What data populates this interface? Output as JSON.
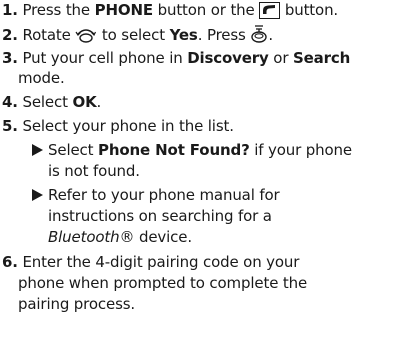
{
  "steps": [
    {
      "num": "1.",
      "a": "Press the ",
      "b": "PHONE",
      "c": " button or the ",
      "d": " button."
    },
    {
      "num": "2.",
      "a": "Rotate ",
      "b": " to select ",
      "c": "Yes",
      "d": ". Press ",
      "e": "."
    },
    {
      "num": "3.",
      "a": "Put your cell phone in ",
      "b": "Discovery",
      "c": " or ",
      "d": "Search",
      "e": "mode."
    },
    {
      "num": "4.",
      "a": "Select ",
      "b": "OK",
      "c": "."
    },
    {
      "num": "5.",
      "a": "Select your phone in the list."
    },
    {
      "num": "6.",
      "line1": "Enter the 4-digit pairing code on your",
      "line2": "phone when prompted to complete the",
      "line3": "pairing process."
    }
  ],
  "sub_items": [
    {
      "a": "Select ",
      "b": "Phone Not Found?",
      "c": " if your phone",
      "line2": "is not found."
    },
    {
      "line1": "Refer to your phone manual for",
      "line2": "instructions on searching for a",
      "italic": "Bluetooth",
      "reg": "®",
      "tail": " device."
    }
  ],
  "icons": {
    "phone_button": "phone-handset-icon",
    "rotate_knob": "rotate-knob-icon",
    "press_knob": "press-knob-icon",
    "arrow": "right-triangle-icon"
  }
}
